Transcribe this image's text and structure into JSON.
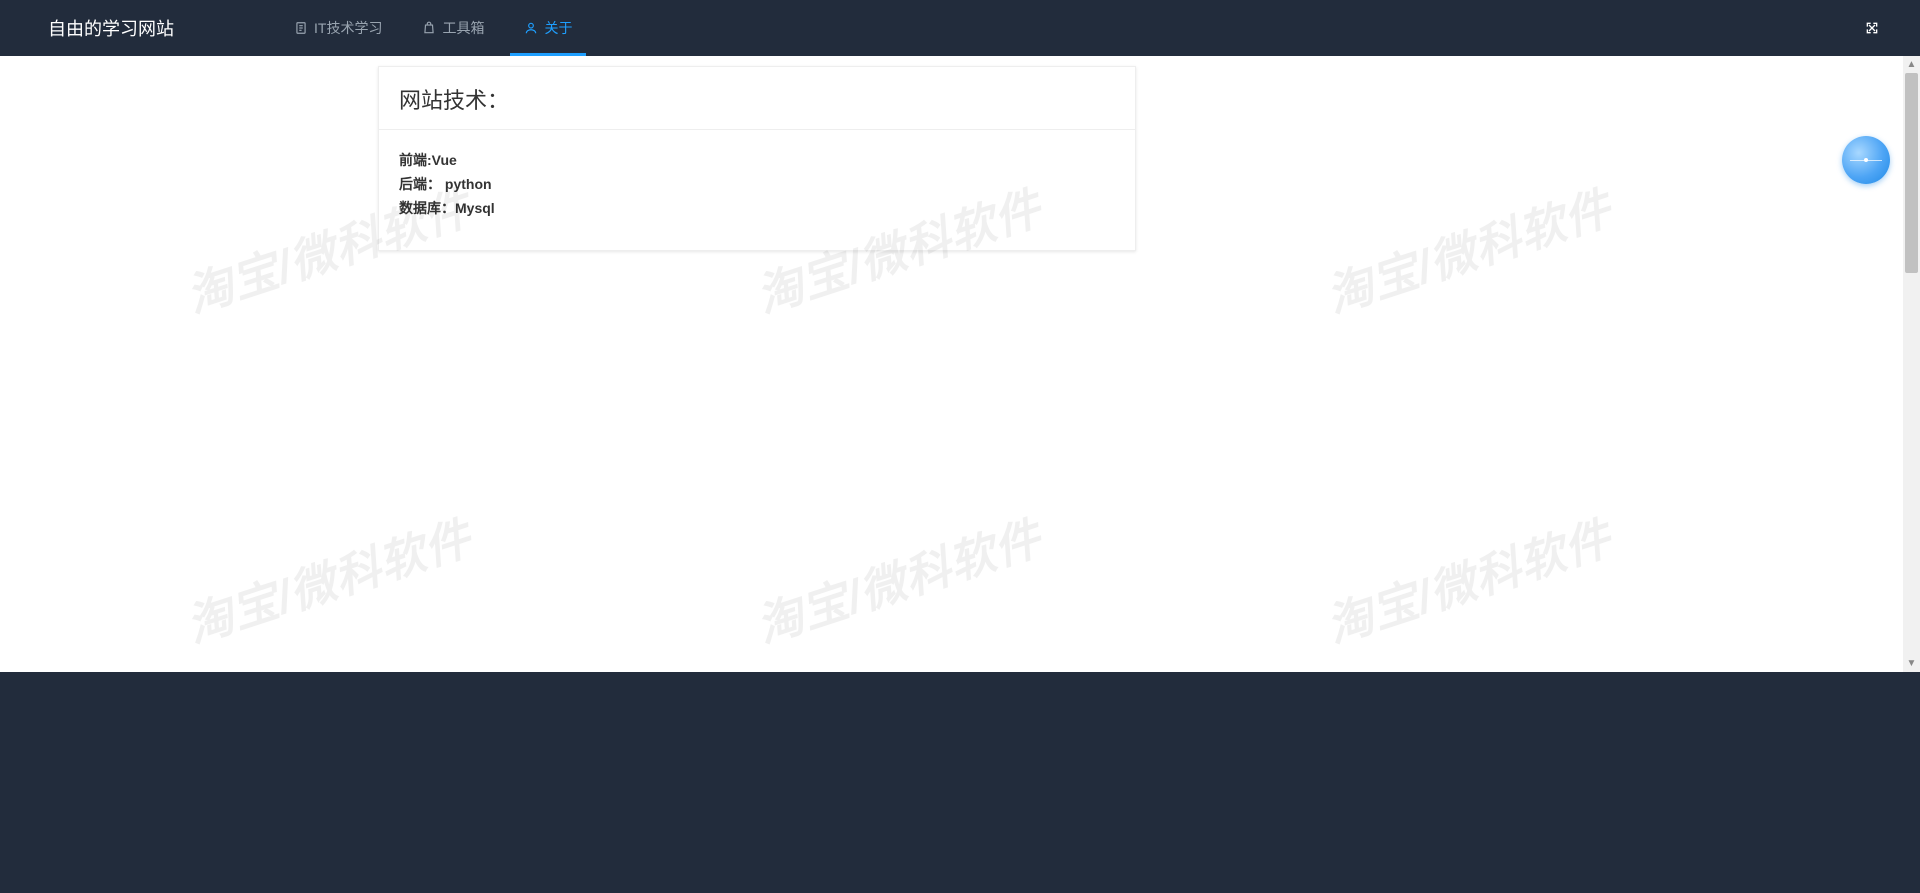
{
  "header": {
    "site_title": "自由的学习网站",
    "nav": [
      {
        "icon": "doc",
        "label": "IT技术学习",
        "active": false
      },
      {
        "icon": "bag",
        "label": "工具箱",
        "active": false
      },
      {
        "icon": "user",
        "label": "关于",
        "active": true
      }
    ]
  },
  "card": {
    "title": "网站技术：",
    "rows": [
      "前端:Vue",
      "后端： python",
      "数据库：Mysql"
    ]
  },
  "watermark_text": "淘宝/微科软件"
}
